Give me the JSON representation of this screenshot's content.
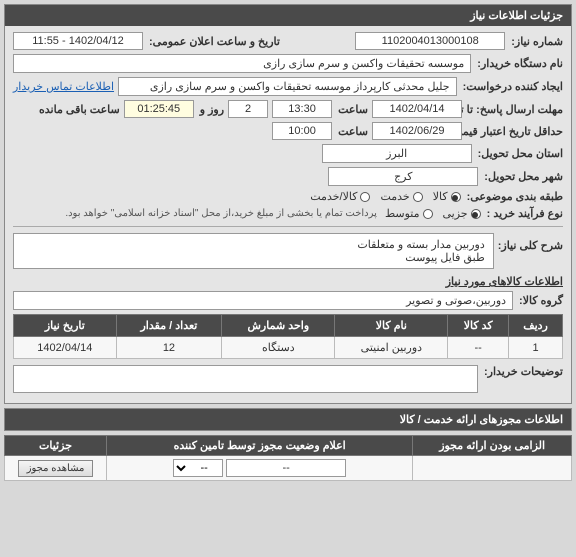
{
  "header": {
    "title": "جزئیات اطلاعات نیاز"
  },
  "fields": {
    "need_no_label": "شماره نیاز:",
    "need_no": "1102004013000108",
    "announce_label": "تاریخ و ساعت اعلان عمومی:",
    "announce": "1402/04/12 - 11:55",
    "buyer_label": "نام دستگاه خریدار:",
    "buyer": "موسسه تحقیقات واکسن و سرم سازی رازی",
    "requester_label": "ایجاد کننده درخواست:",
    "requester": "جلیل محدثی کارپرداز موسسه تحقیقات واکسن و سرم سازی رازی",
    "contact_link": "اطلاعات تماس خریدار",
    "deadline_label": "مهلت ارسال پاسخ: تا تاریخ:",
    "deadline_date": "1402/04/14",
    "time_label": "ساعت",
    "deadline_time": "13:30",
    "day_label": "روز و",
    "day_val": "2",
    "remaining_time": "01:25:45",
    "remaining_label": "ساعت باقی مانده",
    "validity_label": "حداقل تاریخ اعتبار قیمت: تا تاریخ:",
    "validity_date": "1402/06/29",
    "validity_time": "10:00",
    "province_label": "استان محل تحویل:",
    "province": "البرز",
    "city_label": "شهر محل تحویل:",
    "city": "کرج",
    "category_label": "طبقه بندی موضوعی:",
    "cat_goods": "کالا",
    "cat_service": "خدمت",
    "cat_both": "کالا/خدمت",
    "buy_type_label": "نوع فرآیند خرید :",
    "bt_minor": "جزیی",
    "bt_medium": "متوسط",
    "buy_note": "پرداخت تمام یا بخشی از مبلغ خرید،از محل \"اسناد خزانه اسلامی\" خواهد بود.",
    "desc_title": "شرح کلی نیاز:",
    "desc_line1": "دوربین مدار بسته و متعلقات",
    "desc_line2": "طبق فایل پیوست",
    "goods_title": "اطلاعات کالاهای مورد نیاز",
    "group_label": "گروه کالا:",
    "group_val": "دوربین،صوتی و تصویر",
    "buyer_note_label": "توضیحات خریدار:"
  },
  "goods_table": {
    "headers": {
      "row": "ردیف",
      "code": "کد کالا",
      "name": "نام کالا",
      "unit": "واحد شمارش",
      "qty": "تعداد / مقدار",
      "date": "تاریخ نیاز"
    },
    "rows": [
      {
        "row": "1",
        "code": "--",
        "name": "دوربین امنیتی",
        "unit": "دستگاه",
        "qty": "12",
        "date": "1402/04/14"
      }
    ]
  },
  "license": {
    "header": "اطلاعات مجوزهای ارائه خدمت / کالا",
    "col_required": "الزامی بودن ارائه مجوز",
    "col_status": "اعلام وضعیت مجوز توسط تامین کننده",
    "col_detail": "جزئیات",
    "status_val": "--",
    "select_placeholder": "--",
    "btn_view": "مشاهده مجوز"
  }
}
